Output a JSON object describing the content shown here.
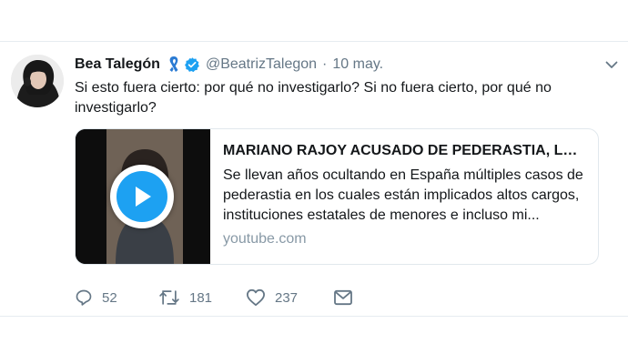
{
  "tweet": {
    "display_name": "Bea Talegón",
    "handle": "@BeatrizTalegon",
    "separator": "·",
    "date": "10 may.",
    "text": "Si esto fuera cierto: por qué no investigarlo? Si no fuera cierto, por qué no investigarlo?",
    "icons": {
      "ribbon": "ribbon-icon",
      "verified": "verified-badge-icon",
      "menu": "chevron-down-icon"
    }
  },
  "card": {
    "title": "MARIANO RAJOY ACUSADO DE PEDERASTIA, LA...",
    "description": "Se llevan años ocultando en España múltiples casos de pederastia en los cuales están implicados altos cargos, instituciones estatales de menores e incluso mi...",
    "domain": "youtube.com",
    "media_icon": "play-icon"
  },
  "actions": {
    "reply_count": "52",
    "retweet_count": "181",
    "like_count": "237",
    "icons": [
      "reply-icon",
      "retweet-icon",
      "like-icon",
      "direct-message-icon"
    ]
  },
  "colors": {
    "accent": "#1da1f2",
    "secondary_text": "#657786",
    "border": "#e1e8ed"
  }
}
